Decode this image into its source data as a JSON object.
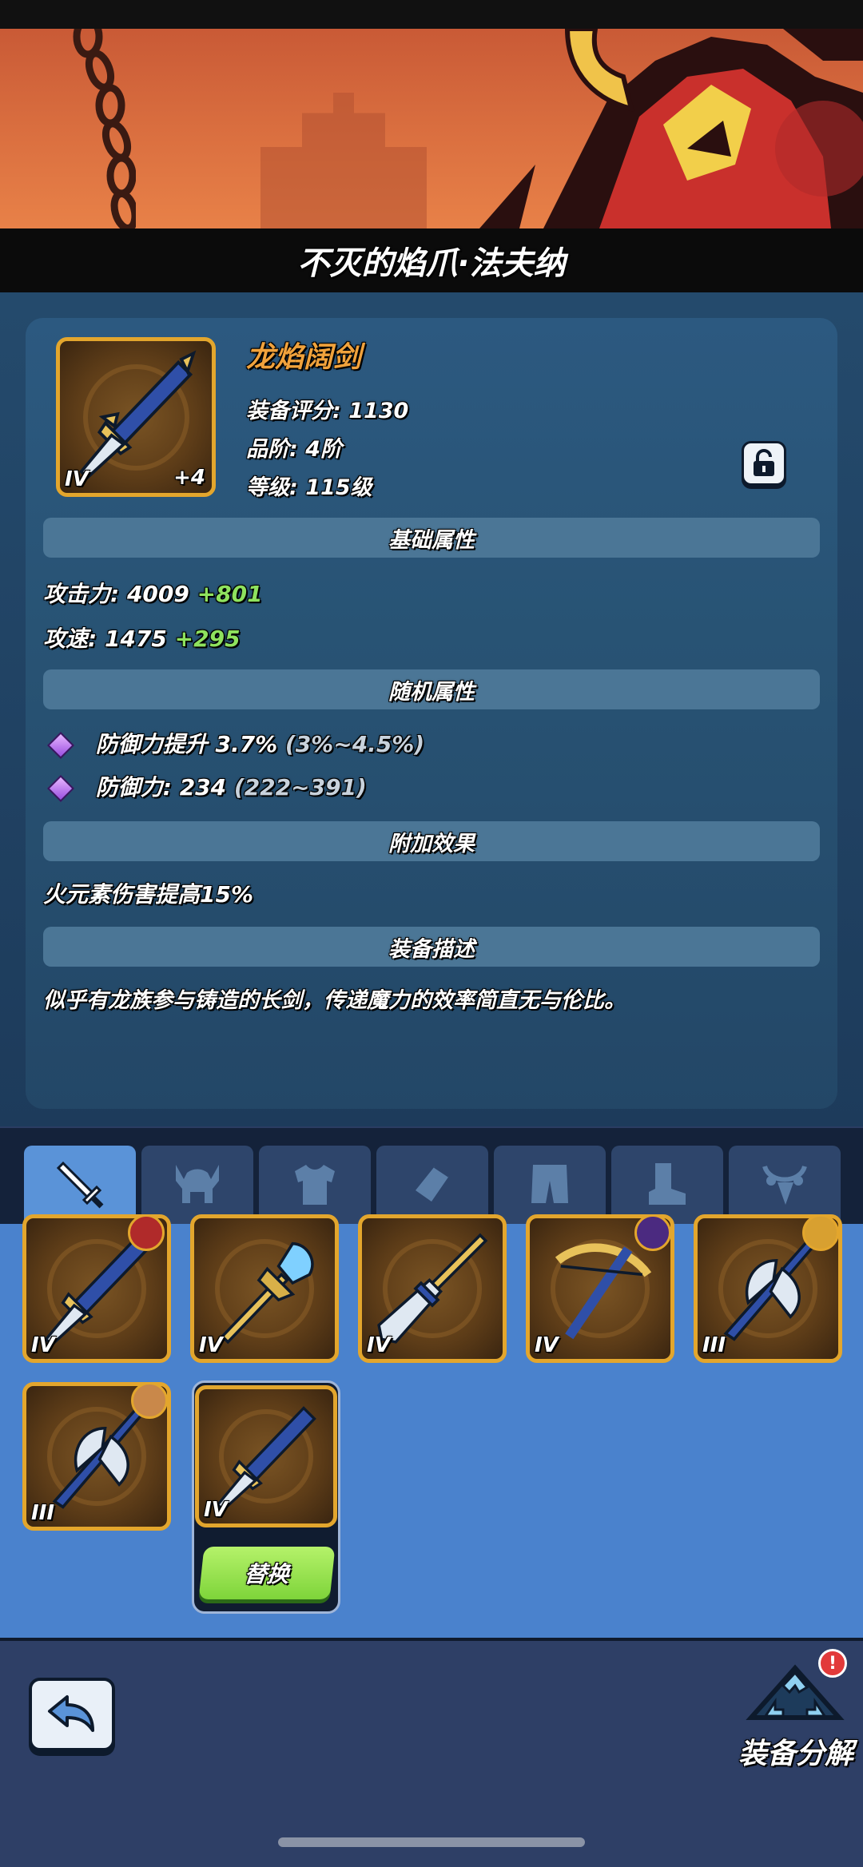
{
  "header": {
    "title": "不灭的焰爪·法夫纳"
  },
  "item": {
    "name": "龙焰阔剑",
    "tier": "IV",
    "enhance": "+4",
    "score_line": "装备评分: 1130",
    "grade_line": "品阶: 4阶",
    "level_line": "等级: 115级"
  },
  "sections": {
    "base": "基础属性",
    "random": "随机属性",
    "extra": "附加效果",
    "desc": "装备描述"
  },
  "base_stats": [
    {
      "label": "攻击力: 4009",
      "bonus": "+801"
    },
    {
      "label": "攻速: 1475",
      "bonus": "+295"
    }
  ],
  "random_stats": [
    {
      "label": "防御力提升 3.7%",
      "range": "(3%~4.5%)"
    },
    {
      "label": "防御力: 234",
      "range": "(222~391)"
    }
  ],
  "extra_effect": "火元素伤害提高15%",
  "description": "似乎有龙族参与铸造的长剑，传递魔力的效率简直无与伦比。",
  "tabs": [
    "sword-icon",
    "helmet-icon",
    "armor-icon",
    "gauntlet-icon",
    "pants-icon",
    "boots-icon",
    "necklace-icon"
  ],
  "inventory": [
    {
      "weapon": "dragon-sword",
      "tier": "IV"
    },
    {
      "weapon": "crystal-staff",
      "tier": "IV"
    },
    {
      "weapon": "spear",
      "tier": "IV"
    },
    {
      "weapon": "crossbow",
      "tier": "IV"
    },
    {
      "weapon": "battle-axe",
      "tier": "III"
    },
    {
      "weapon": "battle-axe",
      "tier": "III"
    },
    {
      "weapon": "dragon-sword",
      "tier": "IV"
    }
  ],
  "replace_label": "替换",
  "salvage_label": "装备分解",
  "alert_mark": "!",
  "colors": {
    "item_name": "#f0a23c",
    "bonus": "#8ee25e",
    "frame": "#e3a62d",
    "replace": "#8ee04a"
  }
}
